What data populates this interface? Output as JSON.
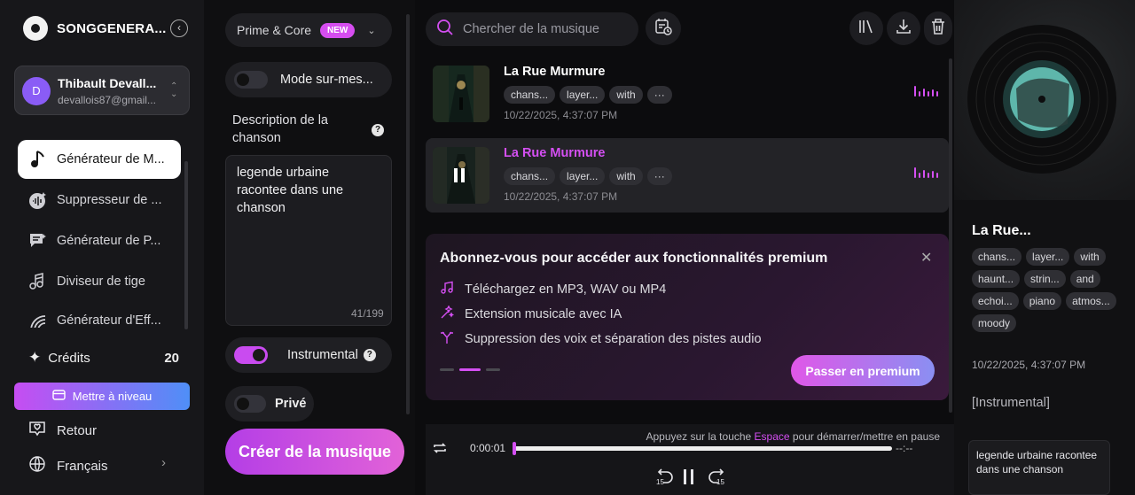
{
  "colors": {
    "accent": "#d44ff2",
    "upgrade_from": "#c64df2",
    "upgrade_to": "#4f8ff7"
  },
  "sidebar": {
    "brand": "SONGGENERA...",
    "user": {
      "initial": "D",
      "name": "Thibault Devall...",
      "email": "devallois87@gmail..."
    },
    "items": [
      {
        "label": "Générateur de M...",
        "icon": "music-note-icon"
      },
      {
        "label": "Suppresseur de ...",
        "icon": "vocal-remover-icon"
      },
      {
        "label": "Générateur de P...",
        "icon": "lyrics-icon"
      },
      {
        "label": "Diviseur de tige",
        "icon": "stem-splitter-icon"
      },
      {
        "label": "Générateur d'Eff...",
        "icon": "sound-effect-icon"
      }
    ],
    "credits_label": "Crédits",
    "credits_value": "20",
    "upgrade_label": "Mettre à niveau",
    "feedback_label": "Retour",
    "language_label": "Français"
  },
  "settings": {
    "model": "Prime & Core",
    "model_badge": "NEW",
    "custom_mode_label": "Mode sur-mes...",
    "description_label": "Description de la chanson",
    "description_value": "legende urbaine racontee dans une chanson",
    "description_count": "41/199",
    "instrumental_label": "Instrumental",
    "instrumental_on": true,
    "private_label": "Privé",
    "private_on": false,
    "create_label": "Créer de la musique"
  },
  "main": {
    "search_placeholder": "Chercher de la musique",
    "tracks": [
      {
        "title": "La Rue Murmure",
        "tags": [
          "chans...",
          "layer...",
          "with",
          "···"
        ],
        "time": "10/22/2025, 4:37:07 PM",
        "selected": false
      },
      {
        "title": "La Rue Murmure",
        "tags": [
          "chans...",
          "layer...",
          "with",
          "···"
        ],
        "time": "10/22/2025, 4:37:07 PM",
        "selected": true
      }
    ],
    "promo": {
      "title": "Abonnez-vous pour accéder aux fonctionnalités premium",
      "items": [
        {
          "label": "Téléchargez en MP3, WAV ou MP4",
          "icon": "music-icon"
        },
        {
          "label": "Extension musicale avec IA",
          "icon": "magic-wand-icon"
        },
        {
          "label": "Suppression des voix et séparation des pistes audio",
          "icon": "split-icon"
        }
      ],
      "button": "Passer en premium"
    },
    "player": {
      "hint_before": "Appuyez sur la touche ",
      "hint_key": "Espace",
      "hint_after": " pour démarrer/mettre en pause",
      "current_time": "0:00:01",
      "end_time": "--:--",
      "progress": 0.0,
      "rewind_label": "15",
      "forward_label": "15"
    }
  },
  "right_panel": {
    "title": "La Rue...",
    "tags": [
      "chans...",
      "layer...",
      "with",
      "haunt...",
      "strin...",
      "and",
      "echoi...",
      "piano",
      "atmos...",
      "moody"
    ],
    "time": "10/22/2025, 4:37:07 PM",
    "instrumental": "[Instrumental]",
    "description": "legende urbaine racontee dans une chanson"
  }
}
